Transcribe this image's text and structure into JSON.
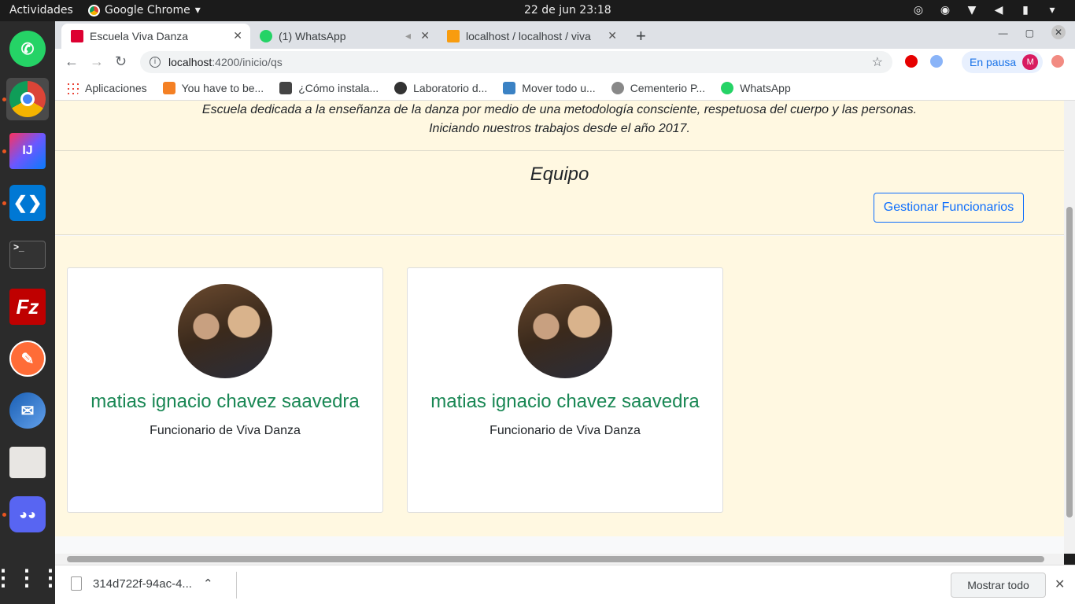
{
  "system": {
    "activities": "Actividades",
    "app_name": "Google Chrome",
    "clock": "22 de jun  23:18"
  },
  "browser": {
    "tabs": [
      {
        "title": "Escuela Viva Danza",
        "icon": "angular-icon",
        "active": true
      },
      {
        "title": "(1) WhatsApp",
        "icon": "whatsapp-icon",
        "active": false
      },
      {
        "title": "localhost / localhost / viva",
        "icon": "phpmyadmin-icon",
        "active": false
      }
    ],
    "url_host": "localhost",
    "url_path": ":4200/inicio/qs",
    "profile_status": "En pausa",
    "profile_initial": "M",
    "bookmarks": [
      {
        "label": "Aplicaciones",
        "icon": "apps-grid-icon"
      },
      {
        "label": "You have to be...",
        "icon": "stackoverflow-icon"
      },
      {
        "label": "¿Cómo instala...",
        "icon": "page-icon"
      },
      {
        "label": "Laboratorio d...",
        "icon": "globe-icon"
      },
      {
        "label": "Mover todo u...",
        "icon": "image-icon"
      },
      {
        "label": "Cementerio P...",
        "icon": "site-icon"
      },
      {
        "label": "WhatsApp",
        "icon": "whatsapp-icon"
      }
    ]
  },
  "page": {
    "intro_line1": "Escuela dedicada a la enseñanza de la danza por medio de una metodología consciente, respetuosa del cuerpo y las personas.",
    "intro_line2": "Iniciando nuestros trabajos desde el año 2017.",
    "team_title": "Equipo",
    "manage_button": "Gestionar Funcionarios",
    "cards": [
      {
        "name": "matias ignacio chavez saavedra",
        "role": "Funcionario de Viva Danza"
      },
      {
        "name": "matias ignacio chavez saavedra",
        "role": "Funcionario de Viva Danza"
      }
    ]
  },
  "downloads": {
    "file": "314d722f-94ac-4...",
    "show_all": "Mostrar todo"
  },
  "colors": {
    "page_bg": "#fff8e1",
    "name_color": "#198754",
    "button_color": "#0d6efd"
  }
}
